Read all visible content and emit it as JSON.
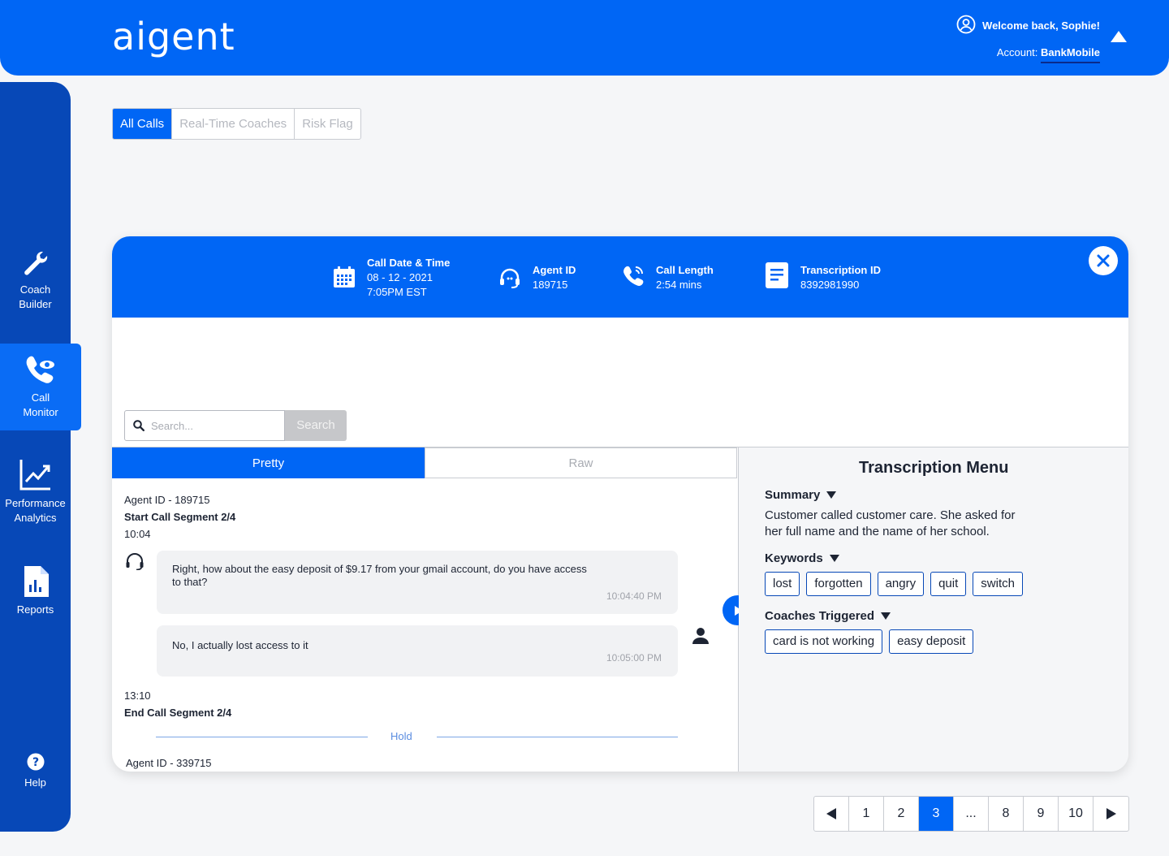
{
  "brand": {
    "logo": "aigent",
    "primary": "#0066f5",
    "sidebar": "#0748b7"
  },
  "header": {
    "welcome": "Welcome back, Sophie!",
    "account_label": "Account:",
    "account_name": "BankMobile"
  },
  "sidebar": {
    "items": [
      {
        "label1": "Coach",
        "label2": "Builder",
        "icon": "wrench-icon"
      },
      {
        "label1": "Call",
        "label2": "Monitor",
        "icon": "phone-eye-icon",
        "active": true
      },
      {
        "label1": "Performance",
        "label2": "Analytics",
        "icon": "chart-icon"
      },
      {
        "label1": "Reports",
        "icon": "report-icon"
      },
      {
        "label1": "Help",
        "icon": "help-icon"
      }
    ]
  },
  "filters": {
    "tabs": [
      "All Calls",
      "Real-Time Coaches",
      "Risk Flag"
    ],
    "active": 0
  },
  "call": {
    "date_title": "Call Date & Time",
    "date": "08 - 12 - 2021",
    "time": "7:05PM EST",
    "agent_title": "Agent ID",
    "agent_id": "189715",
    "length_title": "Call Length",
    "length": "2:54 mins",
    "transcription_title": "Transcription ID",
    "transcription_id": "8392981990"
  },
  "search": {
    "placeholder": "Search...",
    "button": "Search"
  },
  "views": {
    "tabs": [
      "Pretty",
      "Raw"
    ],
    "active": 0
  },
  "transcript": {
    "agent_line": "Agent ID - 189715",
    "segment_start": "Start Call Segment 2/4",
    "time_start": "10:04",
    "msg1": "Right, how about the easy deposit of $9.17 from your gmail account, do you have access to that?",
    "msg1_time": "10:04:40 PM",
    "msg2": "No, I actually lost access to it",
    "msg2_time": "10:05:00 PM",
    "time_end": "13:10",
    "segment_end": "End Call Segment 2/4",
    "hold": "Hold",
    "next_agent": "Agent ID - 339715"
  },
  "menu": {
    "title": "Transcription Menu",
    "summary_label": "Summary",
    "summary_text": "Customer called customer care. She asked for her full name and the name of her school.",
    "keywords_label": "Keywords",
    "keywords": [
      "lost",
      "forgotten",
      "angry",
      "quit",
      "switch"
    ],
    "coaches_label": "Coaches Triggered",
    "coaches": [
      "card is not working",
      "easy deposit"
    ]
  },
  "pagination": {
    "pages": [
      "1",
      "2",
      "3",
      "...",
      "8",
      "9",
      "10"
    ],
    "active": "3"
  }
}
